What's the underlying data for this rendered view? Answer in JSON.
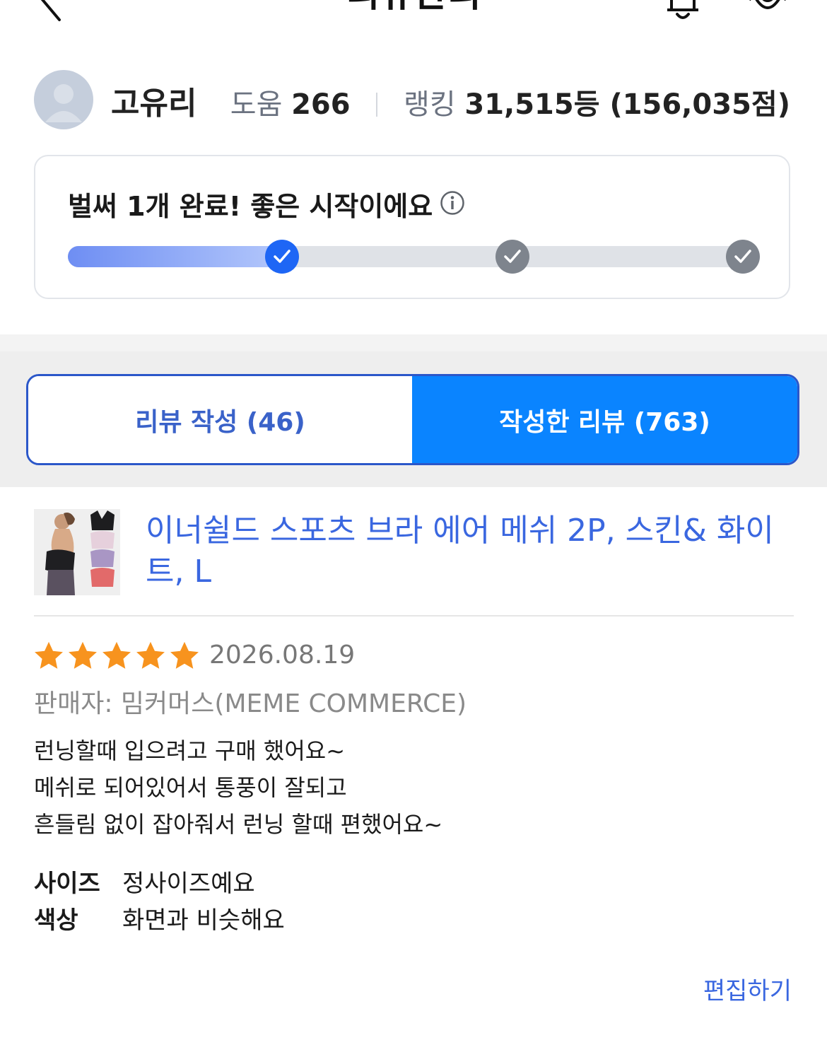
{
  "header": {
    "title": "리뷰관리"
  },
  "profile": {
    "name": "고유리",
    "help_label": "도움",
    "help_value": "266",
    "rank_label": "랭킹",
    "rank_value": "31,515등 (156,035점)"
  },
  "progress": {
    "title": "벌써 1개 완료! 좋은 시작이에요",
    "completed_fraction": 0.31,
    "milestones_done": 1,
    "milestones_total": 3
  },
  "tabs": {
    "write_label": "리뷰 작성 (46)",
    "written_label": "작성한 리뷰 (763)",
    "active": "written"
  },
  "product": {
    "title": "이너쉴드 스포츠 브라 에어 메쉬 2P, 스킨& 화이트, L"
  },
  "review": {
    "rating": 5,
    "date": "2026.08.19",
    "seller": "판매자: 밈커머스(MEME COMMERCE)",
    "body_lines": [
      "런닝할때 입으려고 구매 했어요~",
      "메쉬로 되어있어서 통풍이 잘되고",
      "흔들림 없이 잡아줘서 런닝 할때 편했어요~"
    ],
    "size_label": "사이즈",
    "size_value": "정사이즈예요",
    "color_label": "색상",
    "color_value": "화면과 비슷해요",
    "edit_label": "편집하기"
  },
  "colors": {
    "accent": "#0a84ff",
    "link": "#3a67e0",
    "star": "#f7931e"
  }
}
